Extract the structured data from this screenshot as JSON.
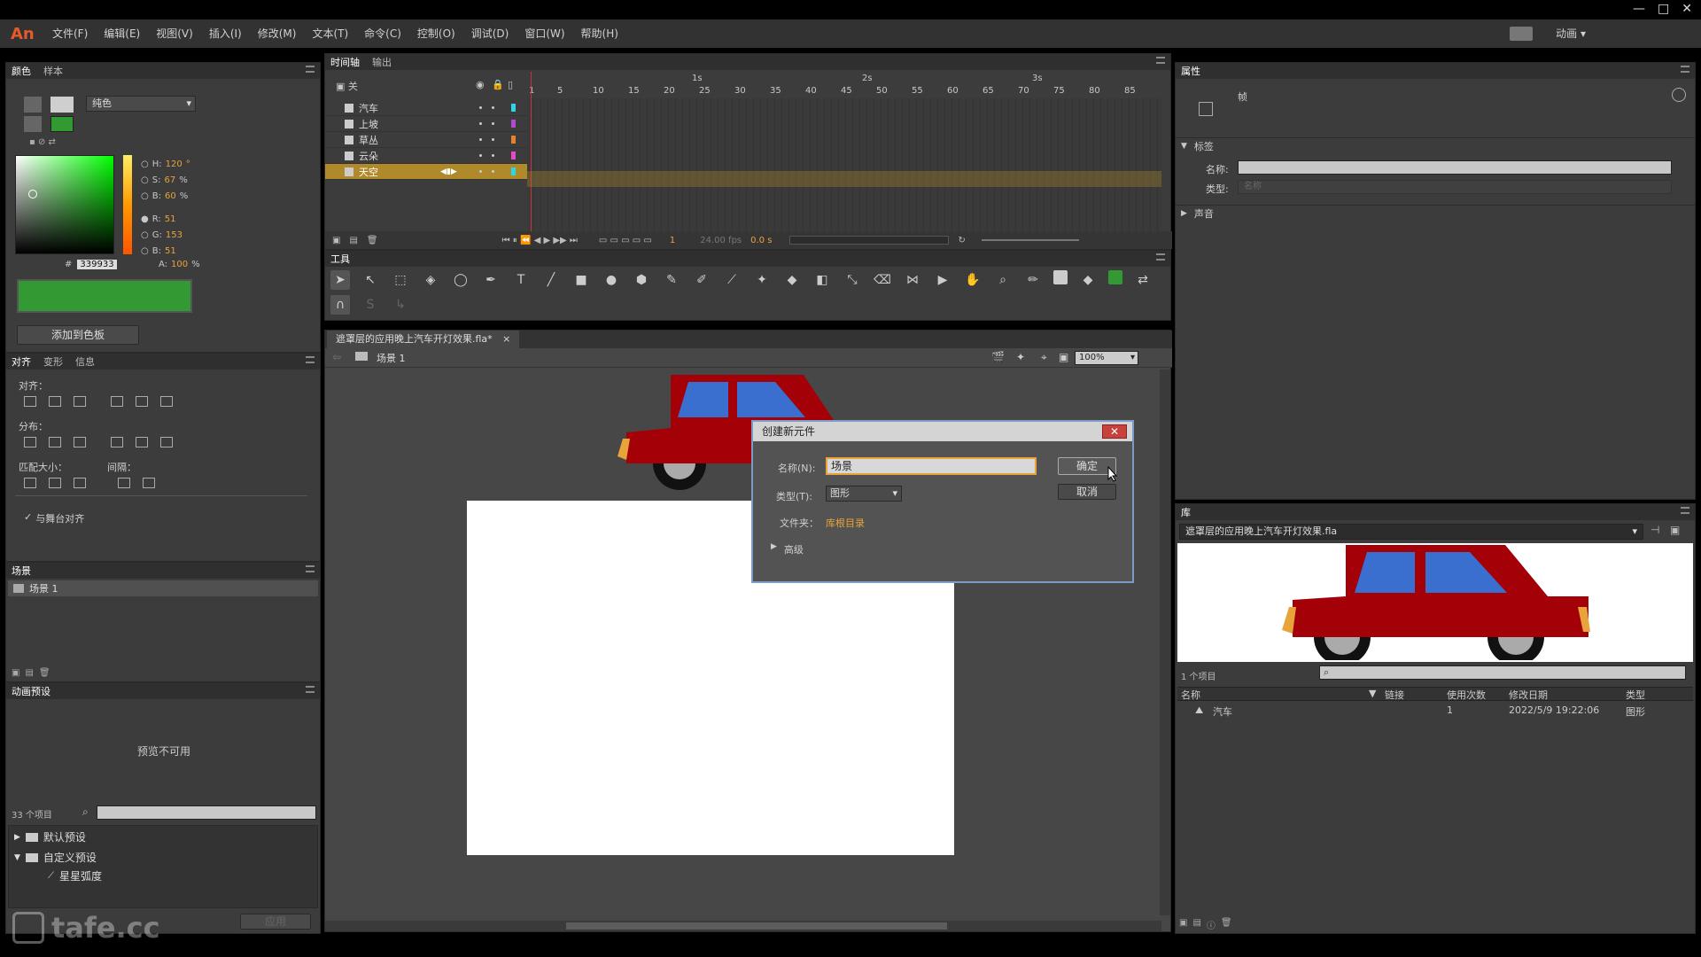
{
  "app": {
    "logo": "An",
    "workspace": "动画"
  },
  "menu": [
    "文件(F)",
    "编辑(E)",
    "视图(V)",
    "插入(I)",
    "修改(M)",
    "文本(T)",
    "命令(C)",
    "控制(O)",
    "调试(D)",
    "窗口(W)",
    "帮助(H)"
  ],
  "color_panel": {
    "tabs": [
      "颜色",
      "样本"
    ],
    "fill_type": "纯色",
    "h_label": "H:",
    "h": "120",
    "s_label": "S:",
    "s": "67",
    "b_label": "B:",
    "b": "60",
    "r_label": "R:",
    "r": "51",
    "g_label": "G:",
    "g": "153",
    "bl_label": "B:",
    "bl": "51",
    "hex_label": "#",
    "hex": "339933",
    "alpha_label": "A:",
    "alpha": "100",
    "degree": "°",
    "percent": "%",
    "swatch_color": "#339933",
    "add_swatch": "添加到色板"
  },
  "align_panel": {
    "tabs": [
      "对齐",
      "变形",
      "信息"
    ],
    "align_label": "对齐：",
    "distribute_label": "分布：",
    "match_size_label": "匹配大小：",
    "spacing_label": "间隔：",
    "to_stage": "与舞台对齐"
  },
  "scene_panel": {
    "title": "场景",
    "item": "场景 1"
  },
  "motion_presets": {
    "title": "动画预设",
    "preview": "预览不可用",
    "count": "33 个项目",
    "folders": [
      "默认预设",
      "自定义预设"
    ],
    "item": "星星弧度",
    "apply": "应用"
  },
  "timeline": {
    "tabs": [
      "时间轴",
      "输出"
    ],
    "header_label": "关",
    "layers": [
      {
        "name": "汽车",
        "color": "#2dd6e6"
      },
      {
        "name": "上坡",
        "color": "#b04ad0"
      },
      {
        "name": "草丛",
        "color": "#e6822d"
      },
      {
        "name": "云朵",
        "color": "#e64ac8"
      },
      {
        "name": "天空",
        "color": "#2dd6e6"
      }
    ],
    "seconds": [
      "1s",
      "2s",
      "3s"
    ],
    "frames": [
      "1",
      "5",
      "10",
      "15",
      "20",
      "25",
      "30",
      "35",
      "40",
      "45",
      "50",
      "55",
      "60",
      "65",
      "70",
      "75",
      "80",
      "85"
    ],
    "current_frame": "1",
    "fps": "24.00 fps",
    "time": "0.0 s"
  },
  "tools_panel": {
    "title": "工具"
  },
  "document": {
    "tab": "遮罩层的应用晚上汽车开灯效果.fla*",
    "scene": "场景 1",
    "zoom": "100%"
  },
  "dialog": {
    "title": "创建新元件",
    "name_label": "名称(N):",
    "name_value": "场景",
    "type_label": "类型(T):",
    "type_value": "图形",
    "folder_label": "文件夹：",
    "folder_value": "库根目录",
    "advanced": "高级",
    "ok": "确定",
    "cancel": "取消"
  },
  "properties": {
    "title": "属性",
    "kind": "帧",
    "label_section": "标签",
    "name_label": "名称:",
    "type_label": "类型:",
    "type_value": "名称",
    "sound_section": "声音"
  },
  "library": {
    "title": "库",
    "file": "遮罩层的应用晚上汽车开灯效果.fla",
    "count": "1 个项目",
    "columns": [
      "名称",
      "链接",
      "使用次数",
      "修改日期",
      "类型"
    ],
    "rows": [
      {
        "name": "汽车",
        "link": "",
        "uses": "1",
        "date": "2022/5/9 19:22:06",
        "type": "图形"
      }
    ]
  },
  "watermark": "tafe.cc"
}
